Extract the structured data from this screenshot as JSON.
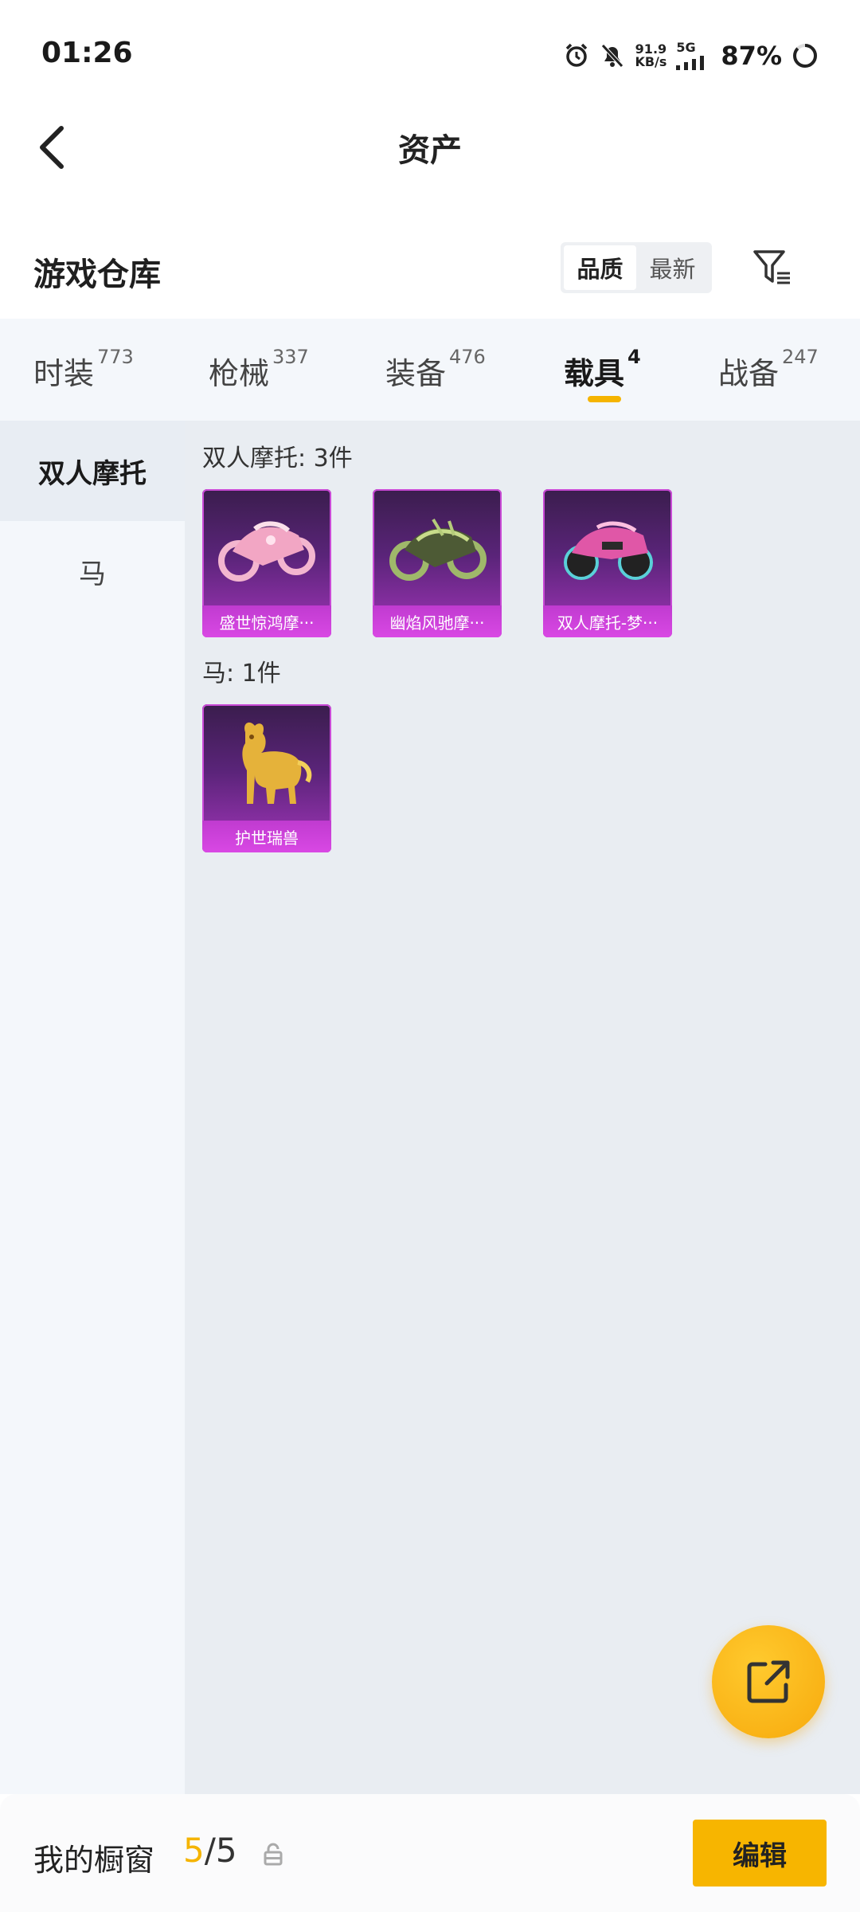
{
  "status": {
    "time": "01:26",
    "speed_value": "91.9",
    "speed_unit": "KB/s",
    "network": "5G",
    "battery": "87%"
  },
  "header": {
    "title": "资产"
  },
  "warehouse": {
    "title": "游戏仓库",
    "sort_options": [
      "品质",
      "最新"
    ],
    "sort_selected": "品质"
  },
  "tabs": [
    {
      "label": "时装",
      "count": "773"
    },
    {
      "label": "枪械",
      "count": "337"
    },
    {
      "label": "装备",
      "count": "476"
    },
    {
      "label": "载具",
      "count": "4"
    },
    {
      "label": "战备",
      "count": "247"
    }
  ],
  "active_tab": "载具",
  "side_categories": [
    {
      "label": "双人摩托"
    },
    {
      "label": "马"
    }
  ],
  "groups": [
    {
      "title": "双人摩托: 3件",
      "items": [
        {
          "name": "盛世惊鸿摩···",
          "icon": "pink-motorcycle-icon",
          "color": "#f0a0c0"
        },
        {
          "name": "幽焰风驰摩···",
          "icon": "green-motorcycle-icon",
          "color": "#a8c070"
        },
        {
          "name": "双人摩托-梦···",
          "icon": "pink-sport-motorcycle-icon",
          "color": "#e05aa8"
        }
      ]
    },
    {
      "title": "马: 1件",
      "items": [
        {
          "name": "护世瑞兽",
          "icon": "golden-beast-icon",
          "color": "#e0b030"
        }
      ]
    }
  ],
  "bottom": {
    "label": "我的橱窗",
    "current": "5",
    "separator_total": "/5",
    "edit_label": "编辑"
  },
  "colors": {
    "accent": "#f5b400",
    "card_bg": "#5a2479",
    "card_label": "#d948e4"
  }
}
